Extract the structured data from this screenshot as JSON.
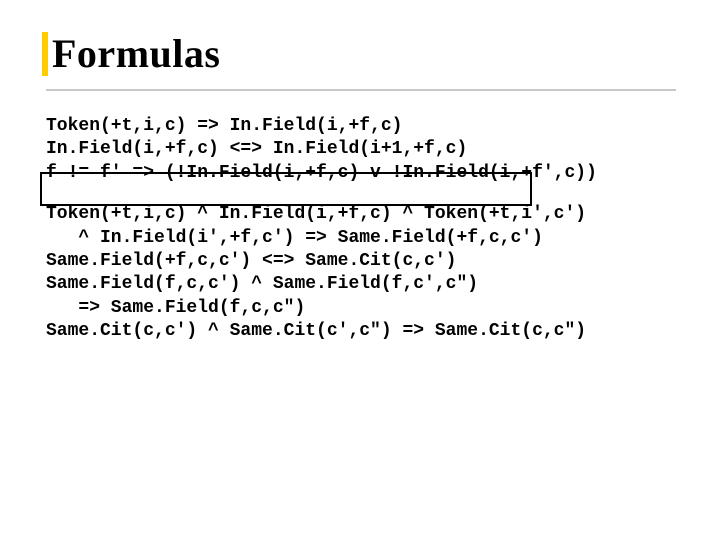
{
  "title": "Formulas",
  "code1": {
    "l1": "Token(+t,i,c) => In.Field(i,+f,c)",
    "l2": "In.Field(i,+f,c) <=> In.Field(i+1,+f,c)",
    "l3": "f != f' => (!In.Field(i,+f,c) v !In.Field(i,+f',c))"
  },
  "code2": {
    "l1": "Token(+t,i,c) ^ In.Field(i,+f,c) ^ Token(+t,i',c')",
    "l2": "   ^ In.Field(i',+f,c') => Same.Field(+f,c,c')",
    "l3": "Same.Field(+f,c,c') <=> Same.Cit(c,c')",
    "l4": "Same.Field(f,c,c') ^ Same.Field(f,c',c\")",
    "l5": "   => Same.Field(f,c,c\")",
    "l6": "Same.Cit(c,c') ^ Same.Cit(c',c\") => Same.Cit(c,c\")"
  }
}
